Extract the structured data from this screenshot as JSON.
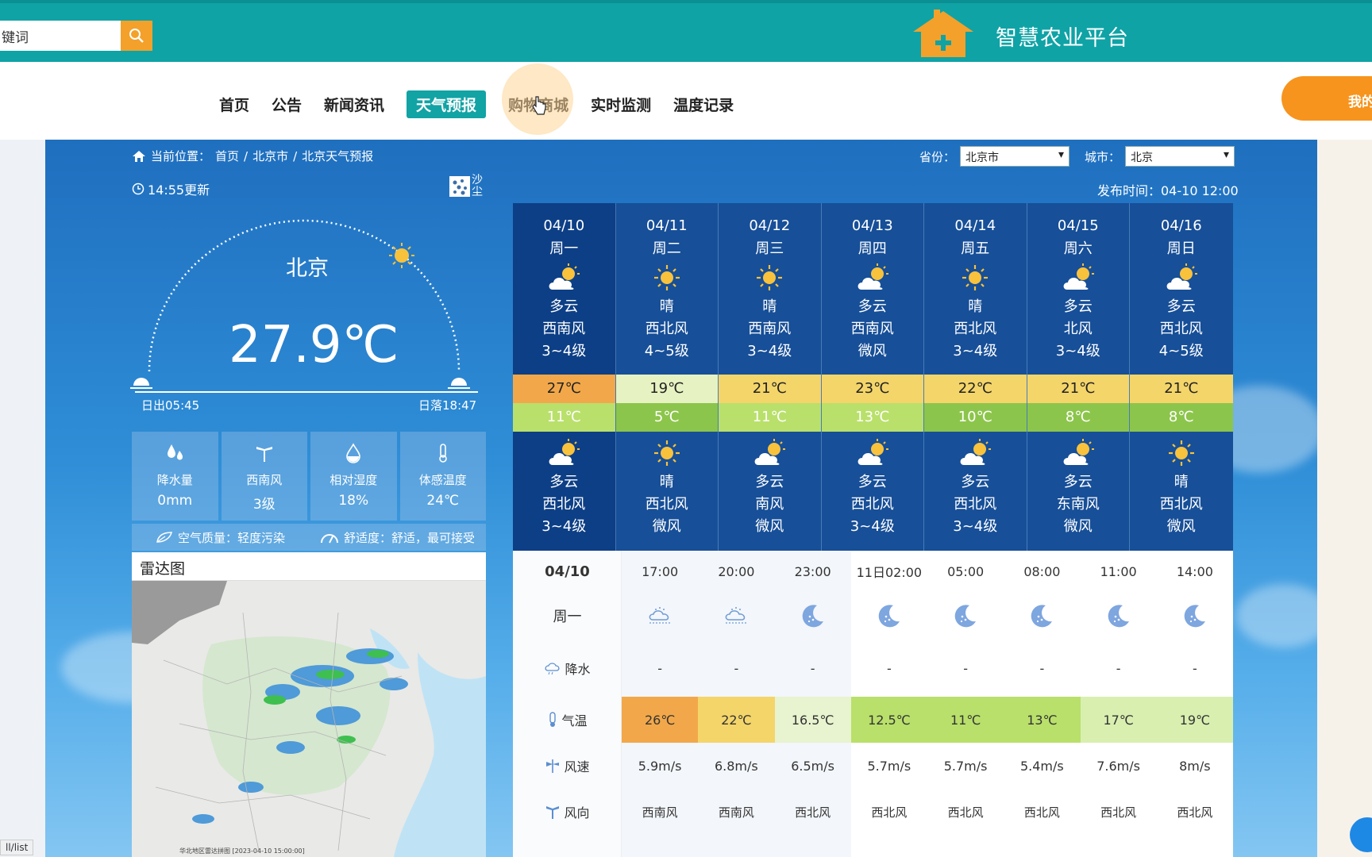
{
  "header": {
    "search_value": "键词",
    "site_title": "智慧农业平台"
  },
  "nav": {
    "items": [
      "首页",
      "公告",
      "新闻资讯",
      "天气预报",
      "购物商城",
      "实时监测",
      "温度记录"
    ],
    "active": "天气预报",
    "user_button": "我的"
  },
  "breadcrumb": {
    "prefix": "当前位置：",
    "items": [
      "首页",
      "北京市",
      "北京天气预报"
    ]
  },
  "selectors": {
    "province_label": "省份：",
    "province_value": "北京市",
    "city_label": "城市：",
    "city_value": "北京"
  },
  "current": {
    "update_time": "14:55更新",
    "sand_label": "沙尘",
    "publish_time": "发布时间：04-10 12:00",
    "city": "北京",
    "temperature": "27.9℃",
    "sunrise": "日出05:45",
    "sunset": "日落18:47",
    "stats": [
      {
        "icon": "rain-drops-icon",
        "label": "降水量",
        "value": "0mm"
      },
      {
        "icon": "wind-turbine-icon",
        "label": "西南风",
        "value": "3级"
      },
      {
        "icon": "humidity-drop-icon",
        "label": "相对湿度",
        "value": "18%"
      },
      {
        "icon": "thermometer-icon",
        "label": "体感温度",
        "value": "24℃"
      }
    ],
    "air_quality": "空气质量：轻度污染",
    "comfort": "舒适度：舒适，最可接受"
  },
  "radar": {
    "title": "雷达图",
    "caption": "华北地区雷达拼图 [2023-04-10 15:00:00]"
  },
  "forecast": [
    {
      "date": "04/10",
      "week": "周一",
      "day_icon": "partly-cloudy",
      "day_weather": "多云",
      "day_wind_dir": "西南风",
      "day_wind_level": "3~4级",
      "high": "27℃",
      "low": "11℃",
      "high_color": "#f2a84a",
      "low_color": "#b9e06b",
      "night_icon": "partly-cloudy",
      "night_weather": "多云",
      "night_wind_dir": "西北风",
      "night_wind_level": "3~4级"
    },
    {
      "date": "04/11",
      "week": "周二",
      "day_icon": "sunny",
      "day_weather": "晴",
      "day_wind_dir": "西北风",
      "day_wind_level": "4~5级",
      "high": "19℃",
      "low": "5℃",
      "high_color": "#e7f2c2",
      "low_color": "#8cc54b",
      "night_icon": "sunny",
      "night_weather": "晴",
      "night_wind_dir": "西北风",
      "night_wind_level": "微风"
    },
    {
      "date": "04/12",
      "week": "周三",
      "day_icon": "sunny",
      "day_weather": "晴",
      "day_wind_dir": "西南风",
      "day_wind_level": "3~4级",
      "high": "21℃",
      "low": "11℃",
      "high_color": "#f4d56a",
      "low_color": "#b9e06b",
      "night_icon": "partly-cloudy",
      "night_weather": "多云",
      "night_wind_dir": "南风",
      "night_wind_level": "微风"
    },
    {
      "date": "04/13",
      "week": "周四",
      "day_icon": "partly-cloudy",
      "day_weather": "多云",
      "day_wind_dir": "西南风",
      "day_wind_level": "微风",
      "high": "23℃",
      "low": "13℃",
      "high_color": "#f4d56a",
      "low_color": "#b9e06b",
      "night_icon": "partly-cloudy",
      "night_weather": "多云",
      "night_wind_dir": "西北风",
      "night_wind_level": "3~4级"
    },
    {
      "date": "04/14",
      "week": "周五",
      "day_icon": "sunny",
      "day_weather": "晴",
      "day_wind_dir": "西北风",
      "day_wind_level": "3~4级",
      "high": "22℃",
      "low": "10℃",
      "high_color": "#f4d56a",
      "low_color": "#8cc54b",
      "night_icon": "partly-cloudy",
      "night_weather": "多云",
      "night_wind_dir": "西北风",
      "night_wind_level": "3~4级"
    },
    {
      "date": "04/15",
      "week": "周六",
      "day_icon": "partly-cloudy",
      "day_weather": "多云",
      "day_wind_dir": "北风",
      "day_wind_level": "3~4级",
      "high": "21℃",
      "low": "8℃",
      "high_color": "#f4d56a",
      "low_color": "#8cc54b",
      "night_icon": "partly-cloudy",
      "night_weather": "多云",
      "night_wind_dir": "东南风",
      "night_wind_level": "微风"
    },
    {
      "date": "04/16",
      "week": "周日",
      "day_icon": "partly-cloudy",
      "day_weather": "多云",
      "day_wind_dir": "西北风",
      "day_wind_level": "4~5级",
      "high": "21℃",
      "low": "8℃",
      "high_color": "#f4d56a",
      "low_color": "#8cc54b",
      "night_icon": "sunny",
      "night_weather": "晴",
      "night_wind_dir": "西北风",
      "night_wind_level": "微风"
    }
  ],
  "hourly": {
    "date": "04/10",
    "week": "周一",
    "times": [
      "17:00",
      "20:00",
      "23:00",
      "11日02:00",
      "05:00",
      "08:00",
      "11:00",
      "14:00"
    ],
    "icons": [
      "haze-icon",
      "haze-icon",
      "moon-icon",
      "moon-icon",
      "moon-icon",
      "moon-icon",
      "moon-icon",
      "moon-icon"
    ],
    "labels": {
      "precip": "降水",
      "temp": "气温",
      "wind_speed": "风速",
      "wind_dir": "风向"
    },
    "precip": [
      "-",
      "-",
      "-",
      "-",
      "-",
      "-",
      "-",
      "-"
    ],
    "temps": [
      "26℃",
      "22℃",
      "16.5℃",
      "12.5℃",
      "11℃",
      "13℃",
      "17℃",
      "19℃"
    ],
    "temp_colors": [
      "#f2a84a",
      "#f4d56a",
      "#e8f3cf",
      "#b9e06b",
      "#b9e06b",
      "#b9e06b",
      "#d9efb0",
      "#d9efb0"
    ],
    "wind_speeds": [
      "5.9m/s",
      "6.8m/s",
      "6.5m/s",
      "5.7m/s",
      "5.7m/s",
      "5.4m/s",
      "7.6m/s",
      "8m/s"
    ],
    "wind_dirs": [
      "西南风",
      "西南风",
      "西北风",
      "西北风",
      "西北风",
      "西北风",
      "西北风",
      "西北风"
    ]
  },
  "status_link": "ll/list"
}
